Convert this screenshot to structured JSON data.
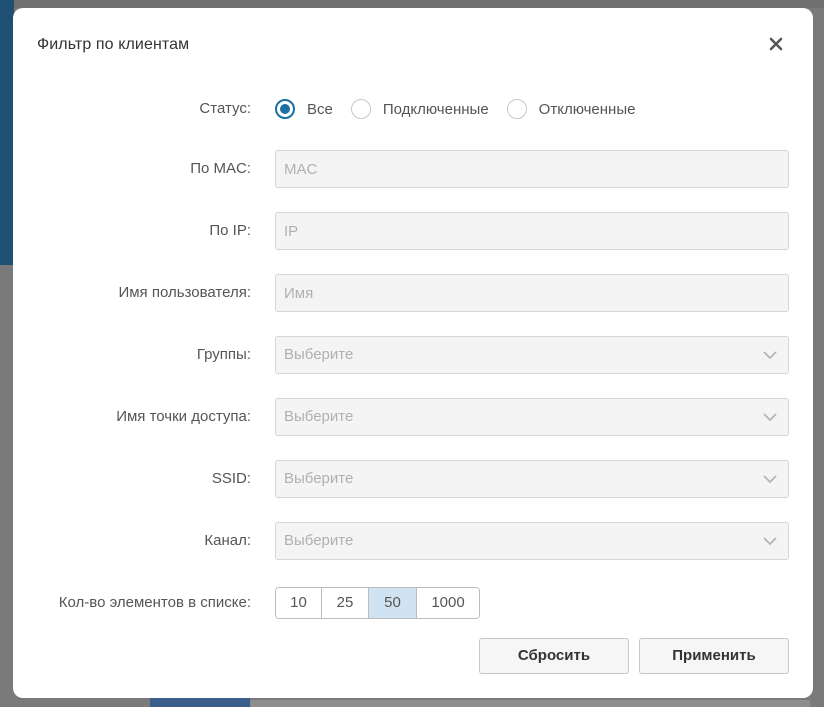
{
  "dialog": {
    "title": "Фильтр по клиентам"
  },
  "status": {
    "label": "Статус:",
    "options": [
      "Все",
      "Подключенные",
      "Отключенные"
    ],
    "selected": "Все"
  },
  "mac": {
    "label": "По MAC:",
    "value": "",
    "placeholder": "MAC"
  },
  "ip": {
    "label": "По IP:",
    "value": "",
    "placeholder": "IP"
  },
  "username": {
    "label": "Имя пользователя:",
    "value": "",
    "placeholder": "Имя"
  },
  "groups": {
    "label": "Группы:",
    "placeholder": "Выберите"
  },
  "ap_name": {
    "label": "Имя точки доступа:",
    "placeholder": "Выберите"
  },
  "ssid": {
    "label": "SSID:",
    "placeholder": "Выберите"
  },
  "channel": {
    "label": "Канал:",
    "placeholder": "Выберите"
  },
  "page_size": {
    "label": "Кол-во элементов в списке:",
    "options": [
      "10",
      "25",
      "50",
      "1000"
    ],
    "selected": "50"
  },
  "buttons": {
    "reset": "Сбросить",
    "apply": "Применить"
  },
  "colors": {
    "accent": "#1a6fa3",
    "active_segment": "#cfe3f2"
  }
}
